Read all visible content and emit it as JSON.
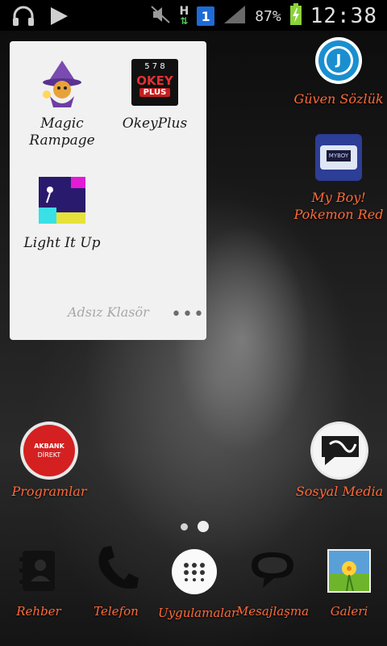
{
  "status_bar": {
    "network_letter": "H",
    "sim_slot": "1",
    "battery": "87%",
    "time": "12:38"
  },
  "folder": {
    "name": "Adsız Klasör",
    "apps": [
      {
        "label": "Magic\nRampage"
      },
      {
        "label": "OkeyPlus"
      },
      {
        "label": "Light It Up"
      }
    ],
    "okey_text": "OKEY",
    "okey_plus": "PLUS",
    "okey_cards": "5 7 8"
  },
  "desktop": {
    "guven_label": "Güven Sözlük",
    "myboy_label_1": "My Boy!",
    "myboy_label_2": "Pokemon Red",
    "myboy_screen": "MYBOY",
    "programlar_label": "Programlar",
    "akbank_text": "AKBANK",
    "direkt_text": "DİREKT",
    "sosyal_label": "Sosyal Media"
  },
  "dock": {
    "rehber": "Rehber",
    "telefon": "Telefon",
    "uygulamalar": "Uygulamalar",
    "mesajlasma": "Mesajlaşma",
    "galeri": "Galeri"
  },
  "colors": {
    "label_accent": "#ff6a3a",
    "status_bg": "#000000",
    "folder_bg": "#f1f1f1"
  }
}
